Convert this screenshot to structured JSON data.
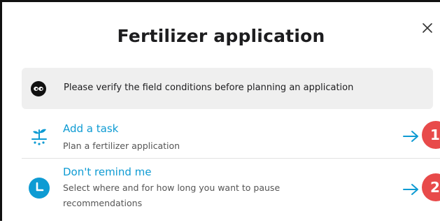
{
  "dialog": {
    "title": "Fertilizer application",
    "close_icon": "close-icon"
  },
  "notice": {
    "icon": "eyes-icon",
    "text": "Please verify the field conditions before planning an application"
  },
  "options": [
    {
      "title": "Add a task",
      "description": "Plan a fertilizer application",
      "icon": "sprout-icon",
      "arrow_icon": "arrow-right-icon"
    },
    {
      "title": "Don't remind me",
      "description": "Select where and for how long you want to pause recommendations",
      "icon": "clock-icon",
      "arrow_icon": "arrow-right-icon"
    }
  ],
  "markers": [
    "1",
    "2"
  ],
  "colors": {
    "accent": "#0e9bd3",
    "marker": "#e84a4a",
    "notice_bg": "#efefef",
    "text": "#1d1d1f"
  }
}
